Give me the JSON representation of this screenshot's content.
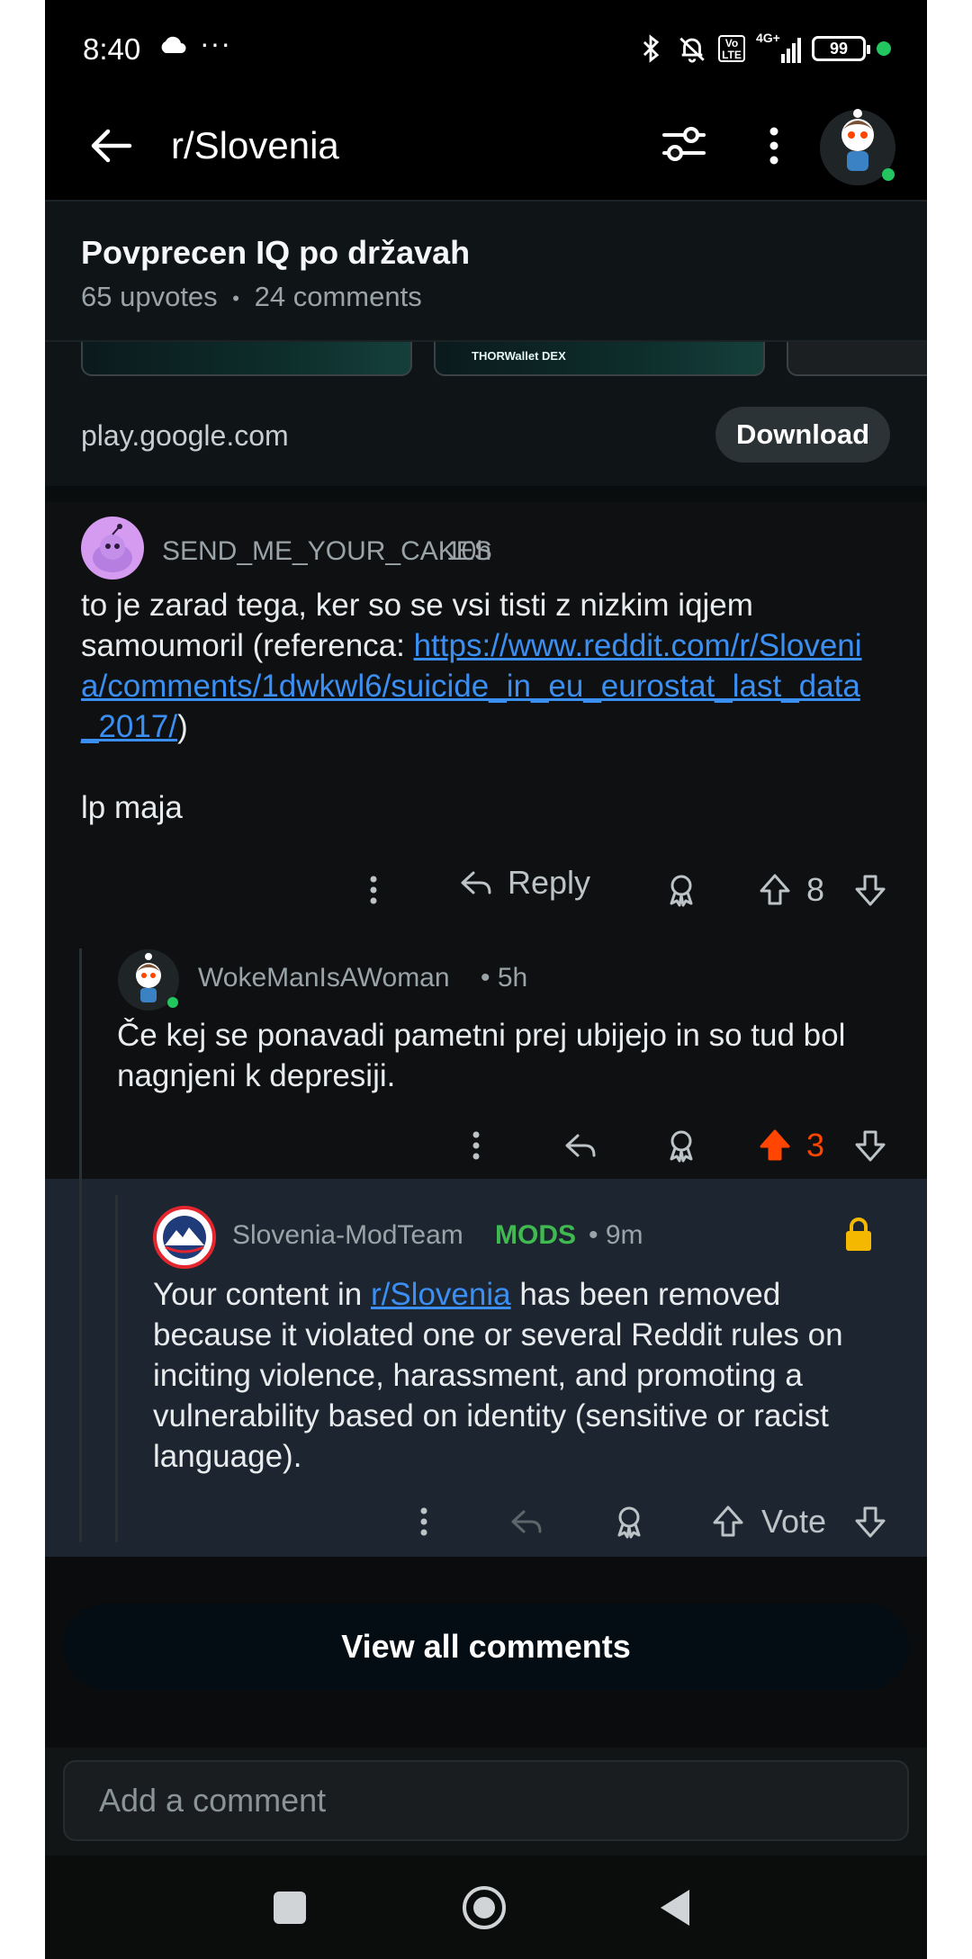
{
  "status_bar": {
    "time": "8:40",
    "battery": "99",
    "network": "4G+",
    "volte": "Vo LTE"
  },
  "app_bar": {
    "title": "r/Slovenia"
  },
  "post": {
    "title": "Povprecen IQ po državah",
    "upvotes": "65 upvotes",
    "bullet": "•",
    "comments": "24 comments"
  },
  "ad": {
    "thumb_label": "THORWallet DEX",
    "domain": "play.google.com",
    "download_label": "Download"
  },
  "comments": [
    {
      "username": "SEND_ME_YOUR_CAKES",
      "age": "10h",
      "text_before_link": "to je zarad tega, ker so se vsi tisti z nizkim iqjem samoumoril (referenca: ",
      "link": "https://www.reddit.com/r/Slovenia/comments/1dwkwl6/suicide_in_eu_eurostat_last_data_2017/",
      "text_after_link": ")",
      "signoff": "lp maja",
      "reply_label": "Reply",
      "score": "8"
    },
    {
      "username": "WokeManIsAWoman",
      "age": "• 5h",
      "text": "Če kej se ponavadi pametni prej ubijejo in so tud bol nagnjeni k depresiji.",
      "score": "3",
      "score_color": "#ff4500"
    },
    {
      "username": "Slovenia-ModTeam",
      "badge": "MODS",
      "age": "• 9m",
      "text_before_link": "Your content in ",
      "link": "r/Slovenia",
      "text_after_link": " has been removed because it violated one or several Reddit rules on inciting violence, harassment, and promoting a vulnerability based on identity (sensitive or racist language).",
      "vote_label": "Vote"
    }
  ],
  "view_all_label": "View all comments",
  "compose": {
    "placeholder": "Add a comment"
  },
  "colors": {
    "accent_orange": "#ff4500",
    "link_blue": "#3b8ff2",
    "mods_green": "#3fb950",
    "lock_yellow": "#f5b800"
  }
}
